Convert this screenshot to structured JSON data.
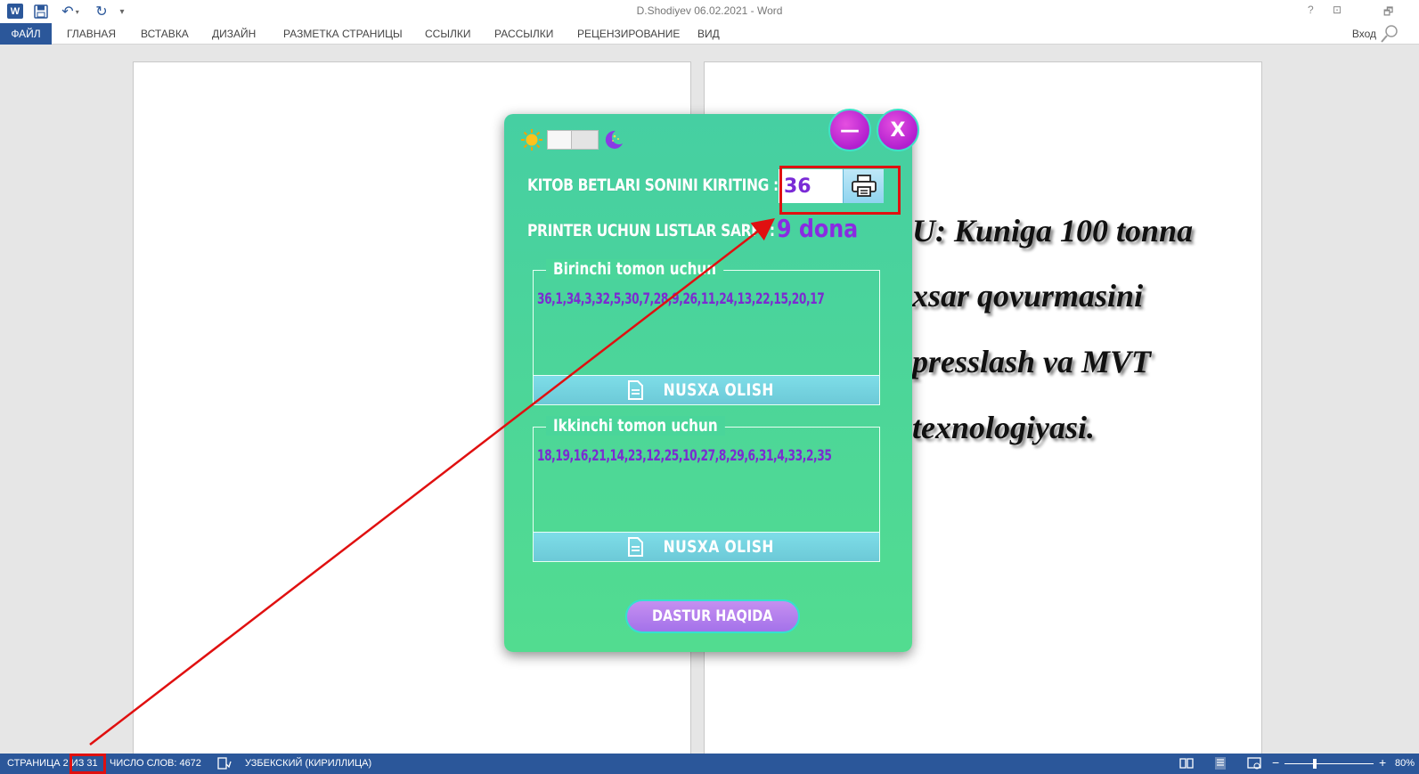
{
  "window": {
    "title": "D.Shodiyev 06.02.2021 - Word",
    "controls": [
      "?",
      "⊡",
      "🗗"
    ]
  },
  "ribbon": {
    "file_tab": "ФАЙЛ",
    "tabs": [
      "ГЛАВНАЯ",
      "ВСТАВКА",
      "ДИЗАЙН",
      "РАЗМЕТКА СТРАНИЦЫ",
      "ССЫЛКИ",
      "РАССЫЛКИ",
      "РЕЦЕНЗИРОВАНИЕ",
      "ВИД"
    ],
    "signin": "Вход"
  },
  "document": {
    "lines": [
      "U: Kuniga 100 tonna",
      "xsar qovurmasini",
      "presslash va MVT",
      "texnologiyasi."
    ]
  },
  "statusbar": {
    "page": "СТРАНИЦА 2 ИЗ 31",
    "words": "ЧИСЛО СЛОВ: 4672",
    "language": "УЗБЕКСКИЙ (КИРИЛЛИЦА)",
    "zoom_minus": "−",
    "zoom_plus": "+",
    "zoom": "80%"
  },
  "app": {
    "minimize_label": "—",
    "close_label": "X",
    "pages_label": "KITOB BETLARI SONINI KIRITING :",
    "pages_value": "36",
    "sheets_label": "PRINTER UCHUN LISTLAR SARFI :",
    "sheets_value": "9 dona",
    "first_side": {
      "title": "Birinchi tomon uchun",
      "sequence": "36,1,34,3,32,5,30,7,28,9,26,11,24,13,22,15,20,17",
      "copy_label": "NUSXA OLISH"
    },
    "second_side": {
      "title": "Ikkinchi tomon uchun",
      "sequence": "18,19,16,21,14,23,12,25,10,27,8,29,6,31,4,33,2,35",
      "copy_label": "NUSXA OLISH"
    },
    "about_label": "DASTUR HAQIDA"
  },
  "colors": {
    "word_blue": "#2b579a",
    "dialog_green": "#46cfa2",
    "accent_purple": "#8a2be2",
    "annotation_red": "#e01010"
  }
}
